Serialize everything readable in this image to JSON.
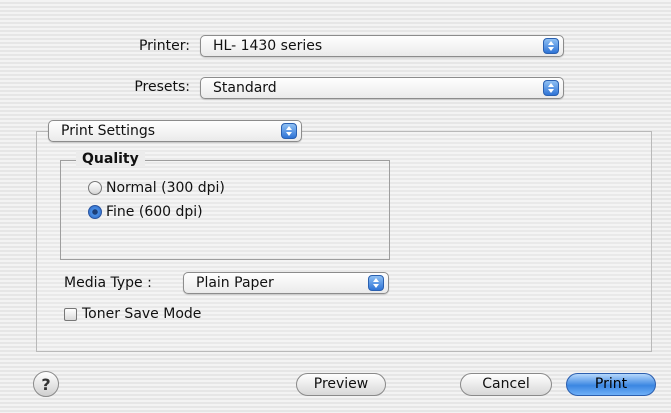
{
  "printer": {
    "label": "Printer:",
    "value": "HL- 1430 series"
  },
  "presets": {
    "label": "Presets:",
    "value": "Standard"
  },
  "section_popup": {
    "value": "Print Settings"
  },
  "quality": {
    "title": "Quality",
    "options": [
      {
        "label": "Normal (300 dpi)",
        "selected": false
      },
      {
        "label": "Fine (600 dpi)",
        "selected": true
      }
    ]
  },
  "media_type": {
    "label": "Media Type :",
    "value": "Plain Paper"
  },
  "toner_save": {
    "label": "Toner Save Mode",
    "checked": false
  },
  "buttons": {
    "help": "?",
    "preview": "Preview",
    "cancel": "Cancel",
    "print": "Print"
  },
  "icons": {
    "popup_arrows": "up-down-arrows-icon",
    "help": "question-mark-icon"
  }
}
